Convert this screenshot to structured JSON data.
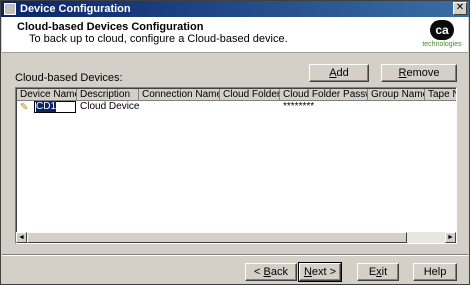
{
  "window": {
    "title": "Device Configuration",
    "close_glyph": "✕"
  },
  "header": {
    "title": "Cloud-based Devices Configuration",
    "subtitle": "To back up to cloud, configure a Cloud-based device."
  },
  "logo": {
    "mark": "ca",
    "text": "technologies"
  },
  "grid": {
    "label": "Cloud-based Devices:",
    "columns": [
      "Device Name",
      "Description",
      "Connection Name",
      "Cloud Folder",
      "Cloud Folder Password",
      "Group Name",
      "Tape Na"
    ],
    "rows": [
      {
        "device_name": "CD1",
        "description": "Cloud Device ...",
        "connection_name": "",
        "cloud_folder": "",
        "cloud_folder_password": "********",
        "group_name": "",
        "tape_name": ""
      }
    ]
  },
  "buttons": {
    "add": {
      "pre": "",
      "ul": "A",
      "post": "dd"
    },
    "remove": {
      "pre": "",
      "ul": "R",
      "post": "emove"
    },
    "back": {
      "pre": "< ",
      "ul": "B",
      "post": "ack"
    },
    "next": {
      "pre": "",
      "ul": "N",
      "post": "ext >"
    },
    "exit": {
      "pre": "E",
      "ul": "x",
      "post": "it"
    },
    "help": {
      "pre": "",
      "ul": "",
      "post": "Help"
    }
  },
  "icons": {
    "edit": "pencil-icon",
    "scroll_left": "◄",
    "scroll_right": "►"
  }
}
